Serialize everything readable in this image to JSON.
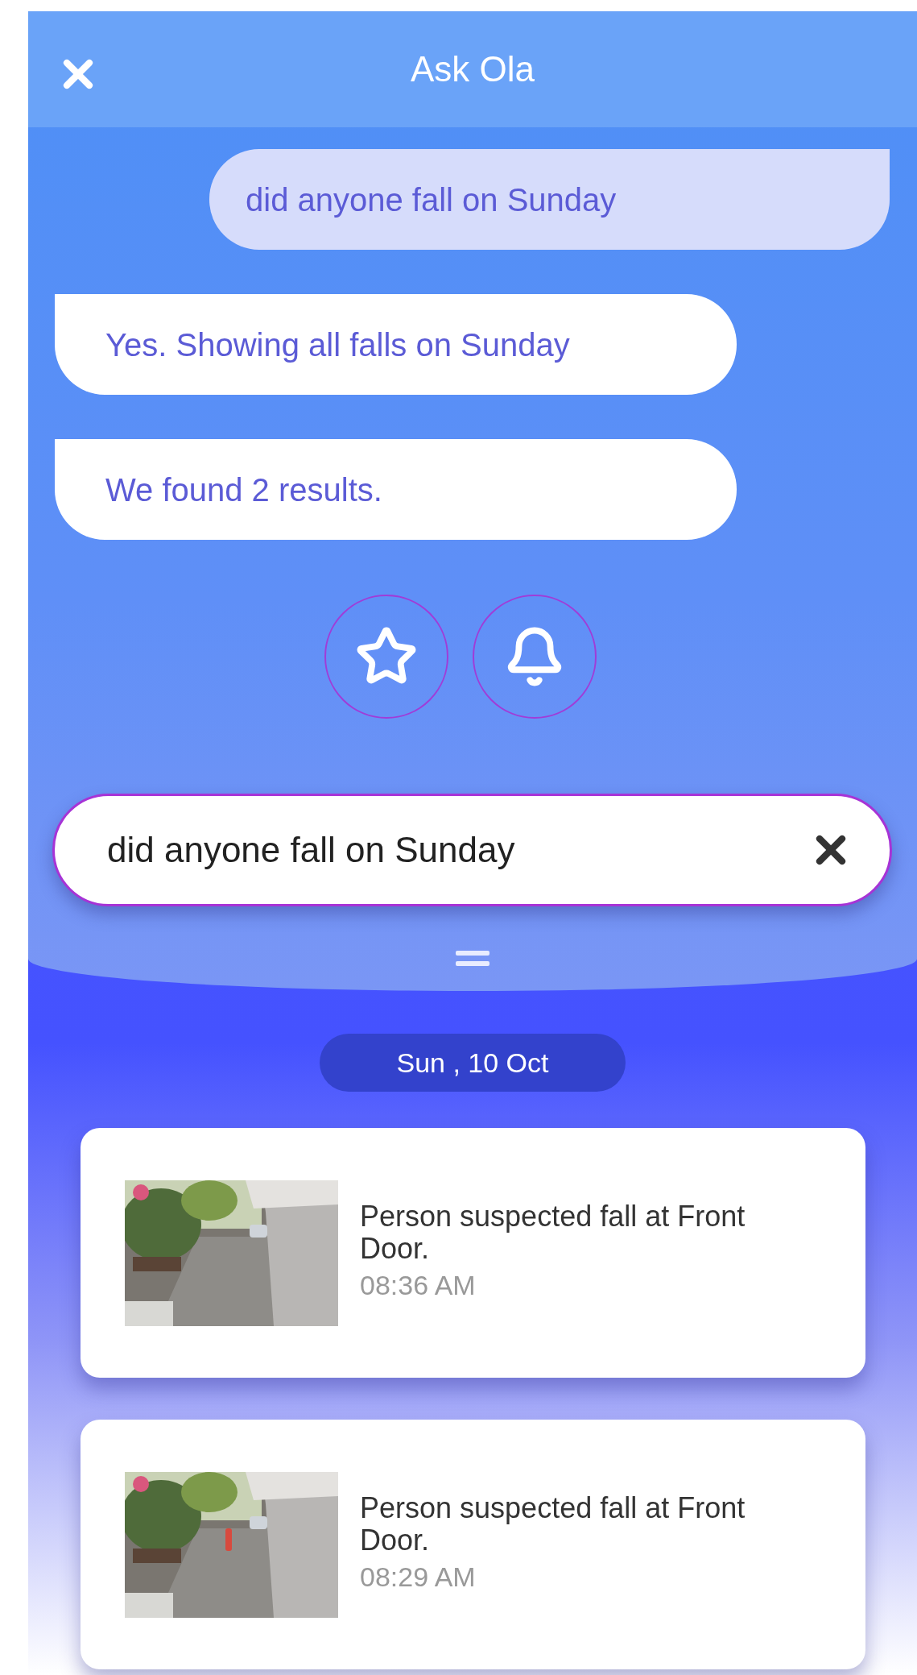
{
  "header": {
    "title": "Ask Ola"
  },
  "messages": [
    {
      "kind": "user",
      "text": "did anyone fall on Sunday"
    },
    {
      "kind": "bot",
      "text": "Yes. Showing all falls on Sunday"
    },
    {
      "kind": "bot",
      "text": "We found 2 results."
    }
  ],
  "search": {
    "value": "did anyone fall on Sunday"
  },
  "date": "Sun , 10 Oct",
  "events": [
    {
      "description": "Person suspected fall at Front Door.",
      "time": "08:36 AM"
    },
    {
      "description": "Person suspected fall at Front Door.",
      "time": "08:29 AM"
    }
  ]
}
